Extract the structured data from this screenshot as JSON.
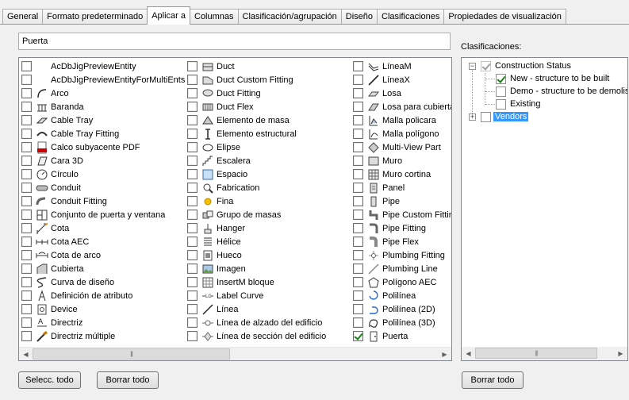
{
  "tabs": [
    {
      "label": "General",
      "active": false
    },
    {
      "label": "Formato predeterminado",
      "active": false
    },
    {
      "label": "Aplicar a",
      "active": true
    },
    {
      "label": "Columnas",
      "active": false
    },
    {
      "label": "Clasificación/agrupación",
      "active": false
    },
    {
      "label": "Diseño",
      "active": false
    },
    {
      "label": "Clasificaciones",
      "active": false
    },
    {
      "label": "Propiedades de visualización",
      "active": false
    }
  ],
  "name_field": {
    "value": "Puerta"
  },
  "entities": {
    "columns": [
      [
        {
          "label": "AcDbJigPreviewEntity",
          "icon": "blank-icon",
          "checked": false
        },
        {
          "label": "AcDbJigPreviewEntityForMultiEnts",
          "icon": "blank-icon",
          "checked": false
        },
        {
          "label": "Arco",
          "icon": "arc-icon",
          "checked": false
        },
        {
          "label": "Baranda",
          "icon": "railing-icon",
          "checked": false
        },
        {
          "label": "Cable Tray",
          "icon": "cable-tray-icon",
          "checked": false
        },
        {
          "label": "Cable Tray Fitting",
          "icon": "cable-tray-fitting-icon",
          "checked": false
        },
        {
          "label": "Calco subyacente PDF",
          "icon": "pdf-underlay-icon",
          "checked": false
        },
        {
          "label": "Cara 3D",
          "icon": "face-3d-icon",
          "checked": false
        },
        {
          "label": "Círculo",
          "icon": "circle-icon",
          "checked": false
        },
        {
          "label": "Conduit",
          "icon": "conduit-icon",
          "checked": false
        },
        {
          "label": "Conduit Fitting",
          "icon": "conduit-fitting-icon",
          "checked": false
        },
        {
          "label": "Conjunto de puerta y ventana",
          "icon": "door-window-assembly-icon",
          "checked": false
        },
        {
          "label": "Cota",
          "icon": "dimension-icon",
          "checked": false
        },
        {
          "label": "Cota AEC",
          "icon": "aec-dimension-icon",
          "checked": false
        },
        {
          "label": "Cota de arco",
          "icon": "arc-dimension-icon",
          "checked": false
        },
        {
          "label": "Cubierta",
          "icon": "roof-icon",
          "checked": false
        },
        {
          "label": "Curva de diseño",
          "icon": "layout-curve-icon",
          "checked": false
        },
        {
          "label": "Definición de atributo",
          "icon": "attribute-definition-icon",
          "checked": false
        },
        {
          "label": "Device",
          "icon": "device-icon",
          "checked": false
        },
        {
          "label": "Directriz",
          "icon": "leader-icon",
          "checked": false
        },
        {
          "label": "Directriz múltiple",
          "icon": "multileader-icon",
          "checked": false
        }
      ],
      [
        {
          "label": "Duct",
          "icon": "duct-icon",
          "checked": false
        },
        {
          "label": "Duct Custom Fitting",
          "icon": "duct-custom-fitting-icon",
          "checked": false
        },
        {
          "label": "Duct Fitting",
          "icon": "duct-fitting-icon",
          "checked": false
        },
        {
          "label": "Duct Flex",
          "icon": "duct-flex-icon",
          "checked": false
        },
        {
          "label": "Elemento de masa",
          "icon": "mass-element-icon",
          "checked": false
        },
        {
          "label": "Elemento estructural",
          "icon": "structural-member-icon",
          "checked": false
        },
        {
          "label": "Elipse",
          "icon": "ellipse-icon",
          "checked": false
        },
        {
          "label": "Escalera",
          "icon": "stair-icon",
          "checked": false
        },
        {
          "label": "Espacio",
          "icon": "space-icon",
          "checked": false
        },
        {
          "label": "Fabrication",
          "icon": "fabrication-icon",
          "checked": false
        },
        {
          "label": "Fina",
          "icon": "sun-icon",
          "checked": false
        },
        {
          "label": "Grupo de masas",
          "icon": "mass-group-icon",
          "checked": false
        },
        {
          "label": "Hanger",
          "icon": "hanger-icon",
          "checked": false
        },
        {
          "label": "Hélice",
          "icon": "helix-icon",
          "checked": false
        },
        {
          "label": "Hueco",
          "icon": "opening-icon",
          "checked": false
        },
        {
          "label": "Imagen",
          "icon": "image-icon",
          "checked": false
        },
        {
          "label": "InsertM bloque",
          "icon": "minsert-block-icon",
          "checked": false
        },
        {
          "label": "Label Curve",
          "icon": "label-curve-icon",
          "checked": false
        },
        {
          "label": "Línea",
          "icon": "line-icon",
          "checked": false
        },
        {
          "label": "Línea de alzado del edificio",
          "icon": "elevation-line-icon",
          "checked": false
        },
        {
          "label": "Línea de sección del edificio",
          "icon": "section-line-icon",
          "checked": false
        }
      ],
      [
        {
          "label": "LíneaM",
          "icon": "mline-icon",
          "checked": false
        },
        {
          "label": "LíneaX",
          "icon": "xline-icon",
          "checked": false
        },
        {
          "label": "Losa",
          "icon": "slab-icon",
          "checked": false
        },
        {
          "label": "Losa para cubierta",
          "icon": "roof-slab-icon",
          "checked": false
        },
        {
          "label": "Malla policara",
          "icon": "polyface-mesh-icon",
          "checked": false
        },
        {
          "label": "Malla polígono",
          "icon": "polygon-mesh-icon",
          "checked": false
        },
        {
          "label": "Multi-View Part",
          "icon": "multi-view-part-icon",
          "checked": false
        },
        {
          "label": "Muro",
          "icon": "wall-icon",
          "checked": false
        },
        {
          "label": "Muro cortina",
          "icon": "curtain-wall-icon",
          "checked": false
        },
        {
          "label": "Panel",
          "icon": "panel-icon",
          "checked": false
        },
        {
          "label": "Pipe",
          "icon": "pipe-icon",
          "checked": false
        },
        {
          "label": "Pipe Custom Fitting",
          "icon": "pipe-custom-fitting-icon",
          "checked": false
        },
        {
          "label": "Pipe Fitting",
          "icon": "pipe-fitting-icon",
          "checked": false
        },
        {
          "label": "Pipe Flex",
          "icon": "pipe-flex-icon",
          "checked": false
        },
        {
          "label": "Plumbing Fitting",
          "icon": "plumbing-fitting-icon",
          "checked": false
        },
        {
          "label": "Plumbing Line",
          "icon": "plumbing-line-icon",
          "checked": false
        },
        {
          "label": "Polígono AEC",
          "icon": "aec-polygon-icon",
          "checked": false
        },
        {
          "label": "Polilínea",
          "icon": "polyline-icon",
          "checked": false
        },
        {
          "label": "Polilínea (2D)",
          "icon": "polyline-2d-icon",
          "checked": false
        },
        {
          "label": "Polilínea (3D)",
          "icon": "polyline-3d-icon",
          "checked": false
        },
        {
          "label": "Puerta",
          "icon": "door-icon",
          "checked": true
        }
      ]
    ]
  },
  "classifications": {
    "label": "Clasificaciones:",
    "tree": [
      {
        "label": "Construction Status",
        "checked": true,
        "disabled": true,
        "expanded": true,
        "children": [
          {
            "label": "New - structure to be built",
            "checked": true
          },
          {
            "label": "Demo - structure to be demolished",
            "checked": false
          },
          {
            "label": "Existing",
            "checked": false
          }
        ]
      },
      {
        "label": "Vendors",
        "checked": false,
        "expanded": false,
        "selected": true,
        "children": []
      }
    ]
  },
  "buttons": {
    "select_all": "Selecc. todo",
    "clear_all": "Borrar todo",
    "clear_all_classifications": "Borrar todo"
  },
  "colors": {
    "selection": "#3399ff",
    "check": "#1a7f1a"
  }
}
